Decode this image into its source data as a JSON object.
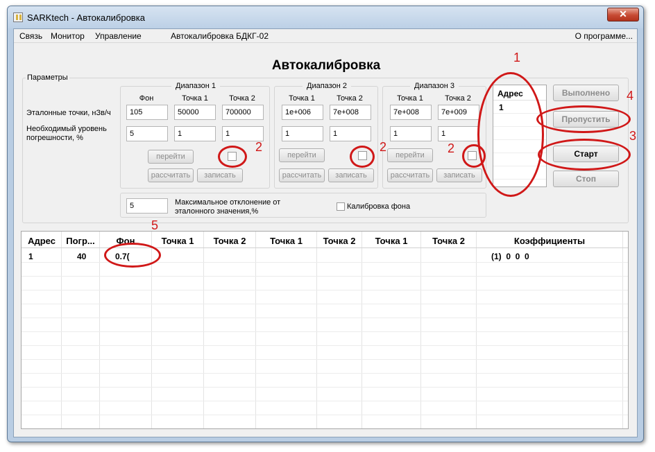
{
  "window": {
    "title": "SARKtech - Автокалибровка",
    "close_label": "✕"
  },
  "menu": {
    "items": [
      "Связь",
      "Монитор",
      "Управление",
      "Автокалибровка БДКГ-02"
    ],
    "about": "О программе..."
  },
  "heading": "Автокалибровка",
  "params": {
    "group_label": "Параметры",
    "row_ref_label": "Эталонные точки, нЗв/ч",
    "row_err_label": "Необходимый уровень погрешности, %",
    "ranges": [
      {
        "title": "Диапазон 1",
        "cols": [
          "Фон",
          "Точка 1",
          "Точка 2"
        ],
        "ref_values": [
          "105",
          "50000",
          "700000"
        ],
        "err_values": [
          "5",
          "1",
          "1"
        ],
        "goto_label": "перейти",
        "calc_label": "рассчитать",
        "write_label": "записать"
      },
      {
        "title": "Диапазон 2",
        "cols": [
          "Точка 1",
          "Точка 2"
        ],
        "ref_values": [
          "1e+006",
          "7e+008"
        ],
        "err_values": [
          "1",
          "1"
        ],
        "goto_label": "перейти",
        "calc_label": "рассчитать",
        "write_label": "записать"
      },
      {
        "title": "Диапазон 3",
        "cols": [
          "Точка 1",
          "Точка 2"
        ],
        "ref_values": [
          "7e+008",
          "7e+009"
        ],
        "err_values": [
          "1",
          "1"
        ],
        "goto_label": "перейти",
        "calc_label": "рассчитать",
        "write_label": "записать"
      }
    ],
    "max_dev_value": "5",
    "max_dev_label": "Максимальное отклонение от эталонного значения,%",
    "bg_calib_label": "Калибровка фона"
  },
  "address_list": {
    "header": "Адрес",
    "items": [
      "1"
    ]
  },
  "actions": {
    "done": "Выполнено",
    "skip": "Пропустить",
    "start": "Старт",
    "stop": "Стоп"
  },
  "table": {
    "headers": [
      "Адрес",
      "Погр...",
      "Фон",
      "Точка 1",
      "Точка 2",
      "Точка 1",
      "Точка 2",
      "Точка 1",
      "Точка 2",
      "Коэффициенты"
    ],
    "rows": [
      {
        "address": "1",
        "error": "40",
        "background": "0.7(",
        "coeffs": "(1)  0  0  0"
      }
    ]
  },
  "annotations": {
    "labels": [
      "1",
      "2",
      "2",
      "2",
      "3",
      "4",
      "5"
    ],
    "color": "#d01818"
  },
  "colors": {
    "window_frame": "#b9cde3",
    "close_button": "#c74a33",
    "annotation": "#d01818"
  }
}
